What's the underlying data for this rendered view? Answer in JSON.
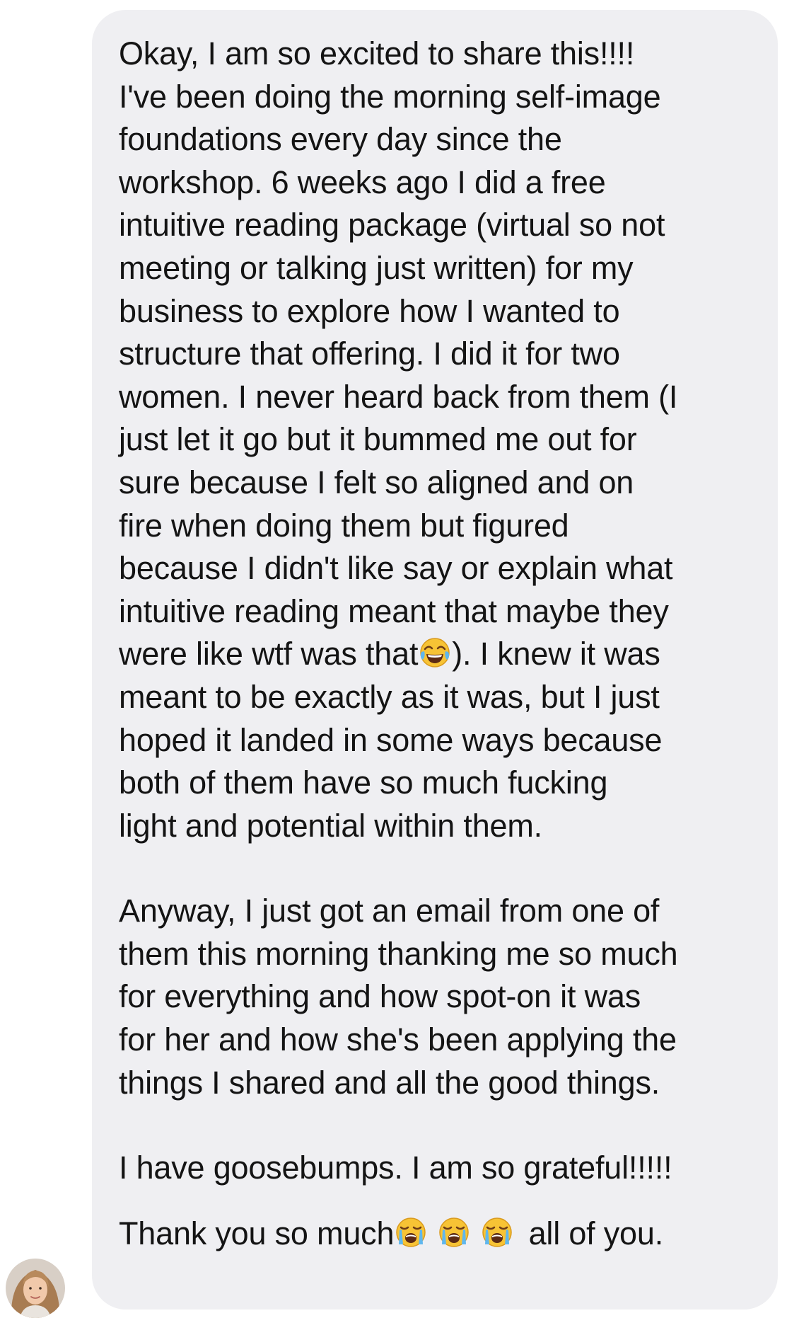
{
  "message": {
    "paragraph_1": [
      "Okay, I am so excited to share this!!!!",
      "I've been doing the morning self-image",
      "foundations every day since the",
      "workshop. 6 weeks ago I did a free",
      "intuitive reading package (virtual so not",
      "meeting or talking just written) for my",
      "business to explore how I wanted to",
      "structure that offering. I did it for two",
      "women. I never heard back from them (I",
      "just let it go but it bummed me out for",
      "sure because I felt so aligned and on",
      "fire when doing them but figured",
      "because I didn't like say or explain what",
      "intuitive reading meant that maybe they"
    ],
    "line_with_emoji_before": "were like wtf was that",
    "line_with_emoji_after": "). I knew it was",
    "paragraph_1_end": [
      "meant to be exactly as it was, but I just",
      "hoped it landed in some ways because",
      "both of them have so much fucking",
      "light and potential within them."
    ],
    "paragraph_2": [
      "Anyway, I just got an email from one of",
      "them this morning thanking me so much",
      "for everything and how spot-on it was",
      "for her and how she's been applying the",
      "things I shared and all the good things."
    ],
    "paragraph_3": "I have goosebumps. I am so grateful!!!!!",
    "closing_before": "Thank you so much",
    "closing_after": " all of you."
  },
  "icons": {
    "laugh_emoji": "face-with-tears-of-joy",
    "cry_emoji": "loudly-crying-face"
  },
  "colors": {
    "bubble_background": "#efeff2",
    "text": "#141414"
  }
}
